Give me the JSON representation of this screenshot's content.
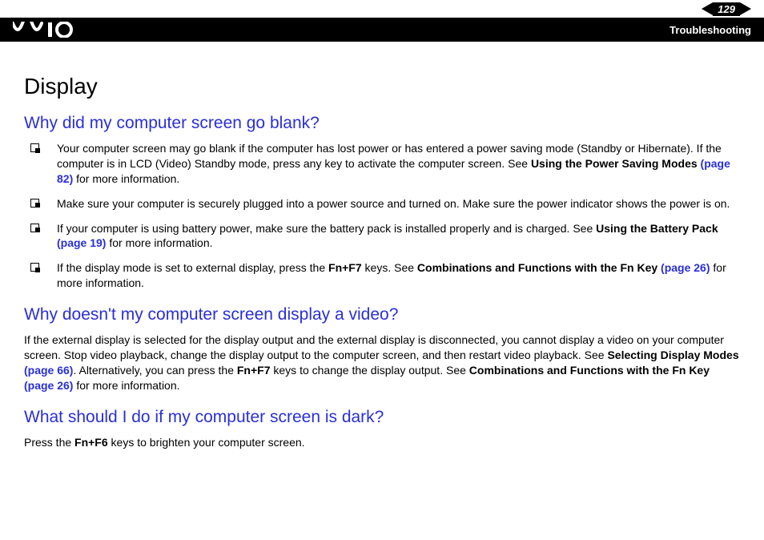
{
  "header": {
    "page_number": "129",
    "section": "Troubleshooting"
  },
  "title": "Display",
  "q1": {
    "heading": "Why did my computer screen go blank?",
    "items": [
      {
        "t1": "Your computer screen may go blank if the computer has lost power or has entered a power saving mode (Standby or Hibernate). If the computer is in LCD (Video) Standby mode, press any key to activate the computer screen. See ",
        "b1": "Using the Power Saving Modes ",
        "l1": "(page 82)",
        "t2": " for more information."
      },
      {
        "t1": "Make sure your computer is securely plugged into a power source and turned on. Make sure the power indicator shows the power is on."
      },
      {
        "t1": "If your computer is using battery power, make sure the battery pack is installed properly and is charged. See ",
        "b1": "Using the Battery Pack ",
        "l1": "(page 19)",
        "t2": " for more information."
      },
      {
        "t1": "If the display mode is set to external display, press the ",
        "b1": "Fn+F7",
        "t2": " keys. See ",
        "b2": "Combinations and Functions with the Fn Key ",
        "l1": "(page 26)",
        "t3": " for more information."
      }
    ]
  },
  "q2": {
    "heading": "Why doesn't my computer screen display a video?",
    "p": {
      "t1": "If the external display is selected for the display output and the external display is disconnected, you cannot display a video on your computer screen. Stop video playback, change the display output to the computer screen, and then restart video playback. See ",
      "b1": "Selecting Display Modes ",
      "l1": "(page 66)",
      "t2": ". Alternatively, you can press the ",
      "b2": "Fn+F7",
      "t3": " keys to change the display output. See ",
      "b3": "Combinations and Functions with the Fn Key ",
      "l2": "(page 26)",
      "t4": " for more information."
    }
  },
  "q3": {
    "heading": "What should I do if my computer screen is dark?",
    "p": {
      "t1": "Press the ",
      "b1": "Fn+F6",
      "t2": " keys to brighten your computer screen."
    }
  }
}
